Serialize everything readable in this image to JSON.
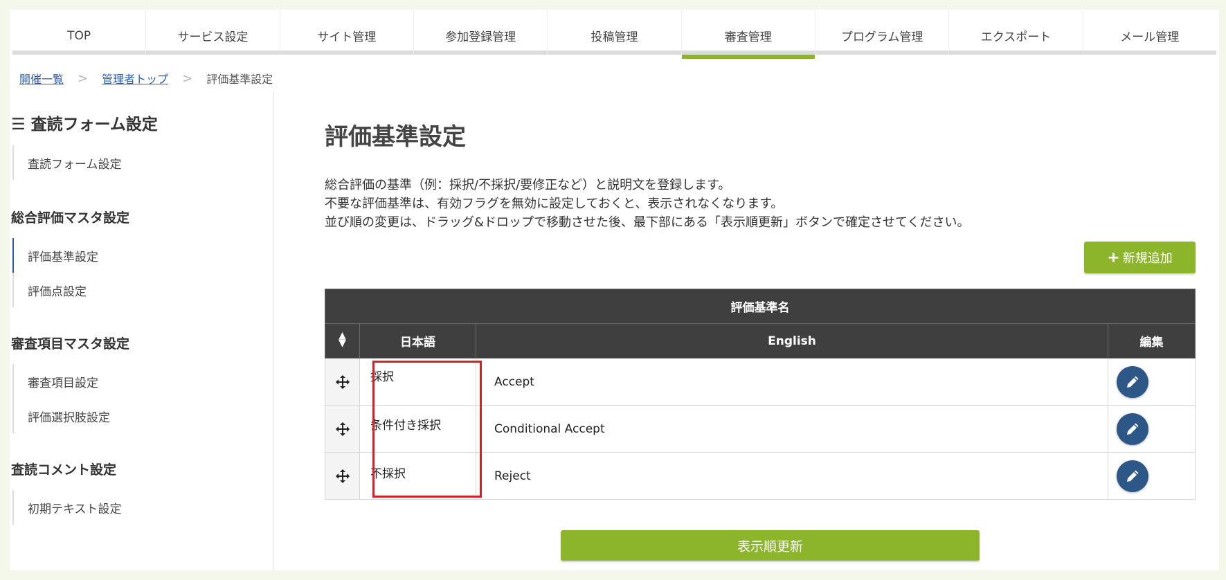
{
  "nav": {
    "items": [
      {
        "label": "TOP"
      },
      {
        "label": "サービス設定"
      },
      {
        "label": "サイト管理"
      },
      {
        "label": "参加登録管理"
      },
      {
        "label": "投稿管理"
      },
      {
        "label": "審査管理",
        "active": true
      },
      {
        "label": "プログラム管理"
      },
      {
        "label": "エクスポート"
      },
      {
        "label": "メール管理"
      }
    ]
  },
  "breadcrumb": {
    "items": [
      "開催一覧",
      "管理者トップ"
    ],
    "current": "評価基準設定",
    "separator": ">"
  },
  "sidebar": {
    "title": "☰ 査読フォーム設定",
    "item_review_form": "査読フォーム設定",
    "section_overall": "総合評価マスタ設定",
    "item_criteria": "評価基準設定",
    "item_points": "評価点設定",
    "section_items": "審査項目マスタ設定",
    "item_review_items": "審査項目設定",
    "item_choices": "評価選択肢設定",
    "section_comment": "査読コメント設定",
    "item_initial_text": "初期テキスト設定"
  },
  "main": {
    "title": "評価基準設定",
    "description": [
      "総合評価の基準（例：採択/不採択/要修正など）と説明文を登録します。",
      "不要な評価基準は、有効フラグを無効に設定しておくと、表示されなくなります。",
      "並び順の変更は、ドラッグ&ドロップで移動させた後、最下部にある「表示順更新」ボタンで確定させてください。"
    ],
    "add_button": "新規追加",
    "add_icon": "plus-icon",
    "update_button": "表示順更新"
  },
  "table": {
    "group_header": "評価基準名",
    "col_sort_icon": "sort-icon",
    "col_ja": "日本語",
    "col_en": "English",
    "col_edit": "編集",
    "rows": [
      {
        "ja": "採択",
        "en": "Accept"
      },
      {
        "ja": "条件付き採択",
        "en": "Conditional Accept"
      },
      {
        "ja": "不採択",
        "en": "Reject"
      }
    ]
  },
  "colors": {
    "accent": "#8db52b",
    "header_bg": "#3f3f3f",
    "edit_button": "#2c5787",
    "highlight": "#d42027",
    "link": "#2a5db0",
    "page_bg": "#f3f8ea"
  }
}
